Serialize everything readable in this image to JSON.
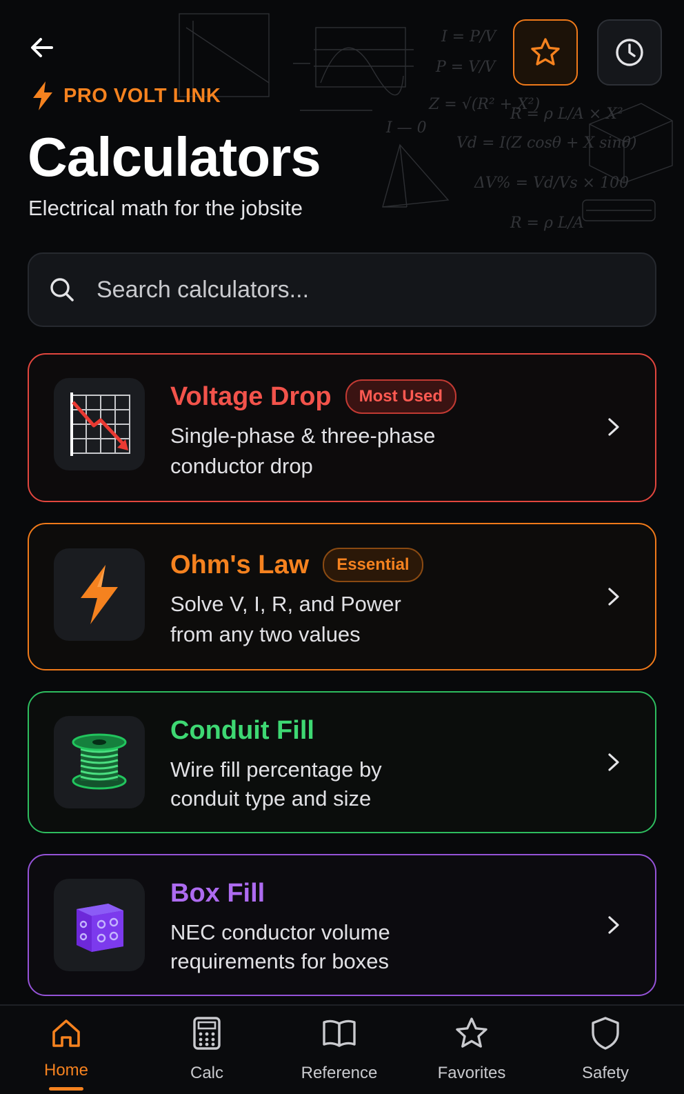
{
  "header": {
    "back_icon": "arrow-left-icon",
    "favorites_icon": "star-icon",
    "history_icon": "clock-icon",
    "brand": "PRO VOLT LINK",
    "title": "Calculators",
    "subtitle": "Electrical math for the jobsite"
  },
  "search": {
    "placeholder": "Search calculators..."
  },
  "calculators": [
    {
      "name": "Voltage Drop",
      "badge": "Most Used",
      "desc_line1": "Single-phase & three-phase",
      "desc_line2": "conductor drop",
      "icon": "voltage-drop-graph-icon",
      "accent": "#e2463e"
    },
    {
      "name": "Ohm's Law",
      "badge": "Essential",
      "desc_line1": "Solve V, I, R, and Power",
      "desc_line2": "from any two values",
      "icon": "lightning-bolt-icon",
      "accent": "#f07a1a"
    },
    {
      "name": "Conduit Fill",
      "desc_line1": "Wire fill percentage by",
      "desc_line2": "conduit type and size",
      "icon": "wire-spool-icon",
      "accent": "#2ebd5f"
    },
    {
      "name": "Box Fill",
      "desc_line1": "NEC conductor volume",
      "desc_line2": "requirements for boxes",
      "icon": "junction-box-icon",
      "accent": "#9553d8"
    }
  ],
  "tabs": [
    {
      "label": "Home",
      "icon": "home-icon",
      "active": true
    },
    {
      "label": "Calc",
      "icon": "calculator-icon"
    },
    {
      "label": "Reference",
      "icon": "book-icon"
    },
    {
      "label": "Favorites",
      "icon": "star-icon"
    },
    {
      "label": "Safety",
      "icon": "shield-icon"
    }
  ],
  "colors": {
    "brand_orange": "#f5821f",
    "background": "#08090b"
  }
}
